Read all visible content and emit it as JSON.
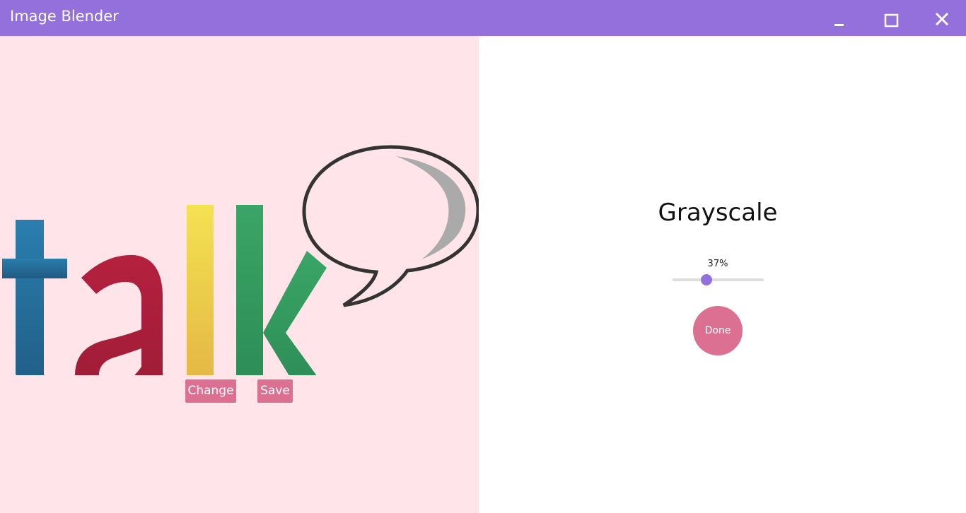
{
  "window": {
    "title": "Image Blender",
    "minimize_icon": "minimize-icon",
    "maximize_icon": "maximize-icon",
    "close_icon": "close-icon"
  },
  "left_panel": {
    "image_text": "talk",
    "change_label": "Change",
    "save_label": "Save"
  },
  "right_panel": {
    "effect_name": "Grayscale",
    "slider_value": 0.37,
    "slider_label": "37%",
    "done_label": "Done"
  },
  "colors": {
    "titlebar": "#9370DB",
    "left_background": "#FFE4E9",
    "button": "#DB7093",
    "slider_thumb": "#9370DB",
    "logo_t": "#236A96",
    "logo_a": "#A81D3C",
    "logo_l": "#EAC04A",
    "logo_k": "#2F9359"
  }
}
